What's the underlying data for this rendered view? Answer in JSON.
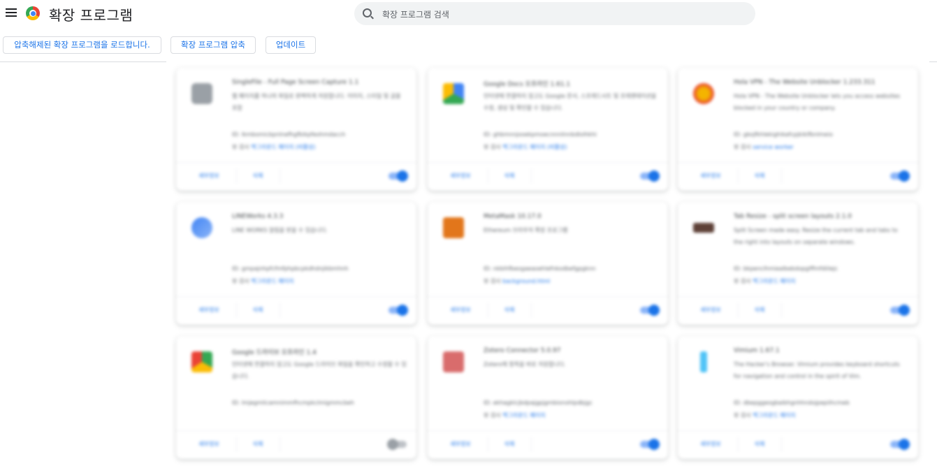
{
  "header": {
    "title": "확장 프로그램",
    "search_placeholder": "확장 프로그램 검색"
  },
  "toolbar": {
    "load_unpacked": "압축해제된 확장 프로그램을 로드합니다.",
    "pack_extension": "확장 프로그램 압축",
    "update": "업데이트"
  },
  "colors": {
    "accent": "#1a73e8",
    "search_bg": "#f1f3f4",
    "toggle_on": "#1a73e8"
  },
  "extensions": [
    {
      "name": "SingleFile - Full Page Screen Capture 1.1",
      "desc": "웹 페이지를 하나의 파일로 완벽하게 저장합니다. 이미지, 스타일 및 글꼴 포함",
      "id": "ID: lkmbomicbpnlnefhgfbikpfeohmdacch",
      "view_label": "뷰 검사",
      "view_link": "백그라운드 페이지 (비활성)",
      "detail": "세부정보",
      "remove": "삭제",
      "enabled": true,
      "icon": "camera-icon"
    },
    {
      "name": "Google Docs 오프라인 1.61.1",
      "desc": "인터넷에 연결하지 않고도 Google 문서, 스프레드시트 및 프레젠테이션을 수정, 생성 및 확인할 수 있습니다.",
      "id": "ID: ghbmnnjooekpmoecnnnilnnbdlolhkhi",
      "view_label": "뷰 검사",
      "view_link": "백그라운드 페이지 (비활성)",
      "detail": "세부정보",
      "remove": "삭제",
      "enabled": true,
      "icon": "google-docs-icon"
    },
    {
      "name": "Hola VPN - The Website Unblocker 1.233.311",
      "desc": "Hola VPN - The Website Unblocker lets you access websites blocked in your country or company.",
      "id": "ID: gkojfkhlekighikafcpjkiklfbnlmeio",
      "view_label": "뷰 검사",
      "view_link": "service worker",
      "detail": "세부정보",
      "remove": "삭제",
      "enabled": true,
      "icon": "hola-icon"
    },
    {
      "name": "LINEWorks 4.3.3",
      "desc": "LINE WORKS 알림을 받을 수 있습니다.",
      "id": "ID: gmpajnhpfcfmfphpbcpkdhdnjikbmhnh",
      "view_label": "뷰 검사",
      "view_link": "백그라운드 페이지",
      "detail": "세부정보",
      "remove": "삭제",
      "enabled": true,
      "icon": "lineworks-icon"
    },
    {
      "name": "MetaMask 10.17.0",
      "desc": "Ethereum 브라우저 확장 프로그램",
      "id": "ID: nkbihfbeogaeaoehlefnkodbefgpgknn",
      "view_label": "뷰 검사",
      "view_link": "background.html",
      "detail": "세부정보",
      "remove": "삭제",
      "enabled": true,
      "icon": "metamask-icon"
    },
    {
      "name": "Tab Resize - split screen layouts 2.1.0",
      "desc": "Split Screen made easy. Resize the current tab and tabs to the right into layouts on separate windows.",
      "id": "ID: bkpenclhmiealbebdopglffmfdiilejc",
      "view_label": "뷰 검사",
      "view_link": "백그라운드 페이지",
      "detail": "세부정보",
      "remove": "삭제",
      "enabled": true,
      "icon": "tab-resize-icon"
    },
    {
      "name": "Google 드라이브 오프라인 1.4",
      "desc": "인터넷에 연결하지 않고도 Google 드라이브 파일을 확인하고 수정할 수 있습니다.",
      "id": "ID: lmjegmlicamnimmfhcmpkclmigmmcbeh",
      "view_label": "",
      "view_link": "",
      "detail": "세부정보",
      "remove": "삭제",
      "enabled": false,
      "icon": "google-drive-icon"
    },
    {
      "name": "Zotero Connector 5.0.97",
      "desc": "Zotero에 항목을 바로 저장합니다.",
      "id": "ID: ekhagklcjbdpajgpjgmbionohlpdbjgc",
      "view_label": "뷰 검사",
      "view_link": "백그라운드 페이지",
      "detail": "세부정보",
      "remove": "삭제",
      "enabled": true,
      "icon": "zotero-icon"
    },
    {
      "name": "Vimium 1.67.1",
      "desc": "The Hacker's Browser. Vimium provides keyboard shortcuts for navigation and control in the spirit of Vim.",
      "id": "ID: dbepggeogbaibhgnhhndojpepiihcmeb",
      "view_label": "뷰 검사",
      "view_link": "백그라운드 페이지",
      "detail": "세부정보",
      "remove": "삭제",
      "enabled": true,
      "icon": "vimium-icon"
    }
  ]
}
